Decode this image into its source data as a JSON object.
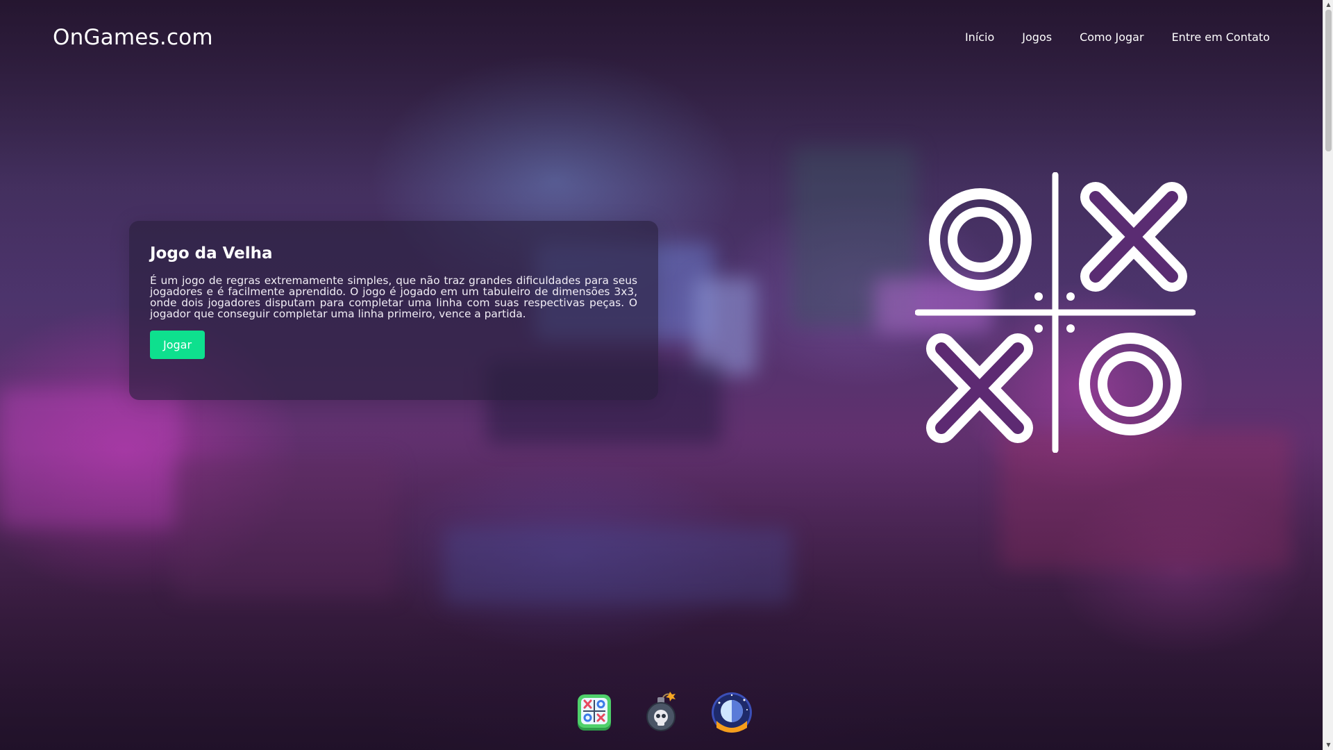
{
  "header": {
    "logo": "OnGames.com",
    "nav": [
      {
        "label": "Início"
      },
      {
        "label": "Jogos"
      },
      {
        "label": "Como Jogar"
      },
      {
        "label": "Entre em Contato"
      }
    ]
  },
  "card": {
    "title": "Jogo da Velha",
    "description": "É um jogo de regras extremamente simples, que não traz grandes dificuldades para seus jogadores e é facilmente aprendido. O jogo é jogado em um tabuleiro de dimensões 3x3, onde dois jogadores disputam para completar uma linha com suas respectivas peças. O jogador que conseguir completar uma linha primeiro, vence a partida.",
    "button_label": "Jogar"
  },
  "game_icons": [
    {
      "icon": "tic-tac-toe-icon"
    },
    {
      "icon": "bomb-skull-icon"
    },
    {
      "icon": "space-orb-icon"
    }
  ],
  "colors": {
    "accent": "#0ee08e",
    "card_bg": "rgba(40,30,60,0.62)"
  }
}
